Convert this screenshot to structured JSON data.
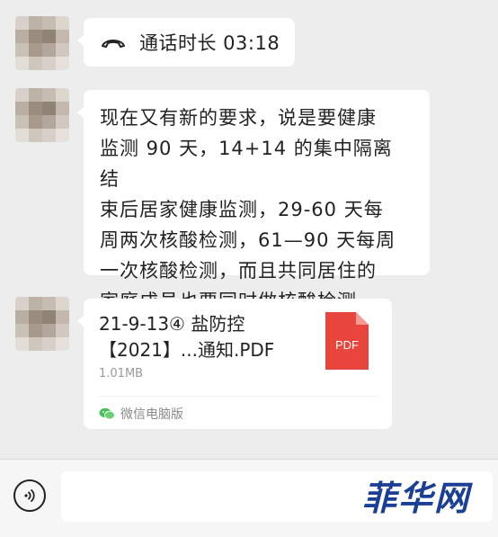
{
  "messages": {
    "call": {
      "icon": "phone-hangup-icon",
      "text": "通话时长 03:18"
    },
    "text": {
      "lines": [
        "现在又有新的要求，说是要健康",
        "监测 90 天，14+14 的集中隔离结",
        "束后居家健康监测，29-60 天每",
        "周两次核酸检测，61—90 天每周",
        "一次核酸检测，而且共同居住的",
        "家庭成员也要同时做核酸检测"
      ]
    },
    "file": {
      "title_line1": "21-9-13④ 盐防控",
      "title_line2": "【2021】...通知.PDF",
      "size": "1.01MB",
      "source": "微信电脑版",
      "badge": "PDF",
      "badge_color": "#e8453c"
    }
  },
  "input_bar": {
    "voice_icon": "voice-icon",
    "input_value": ""
  },
  "watermark": "菲华网"
}
